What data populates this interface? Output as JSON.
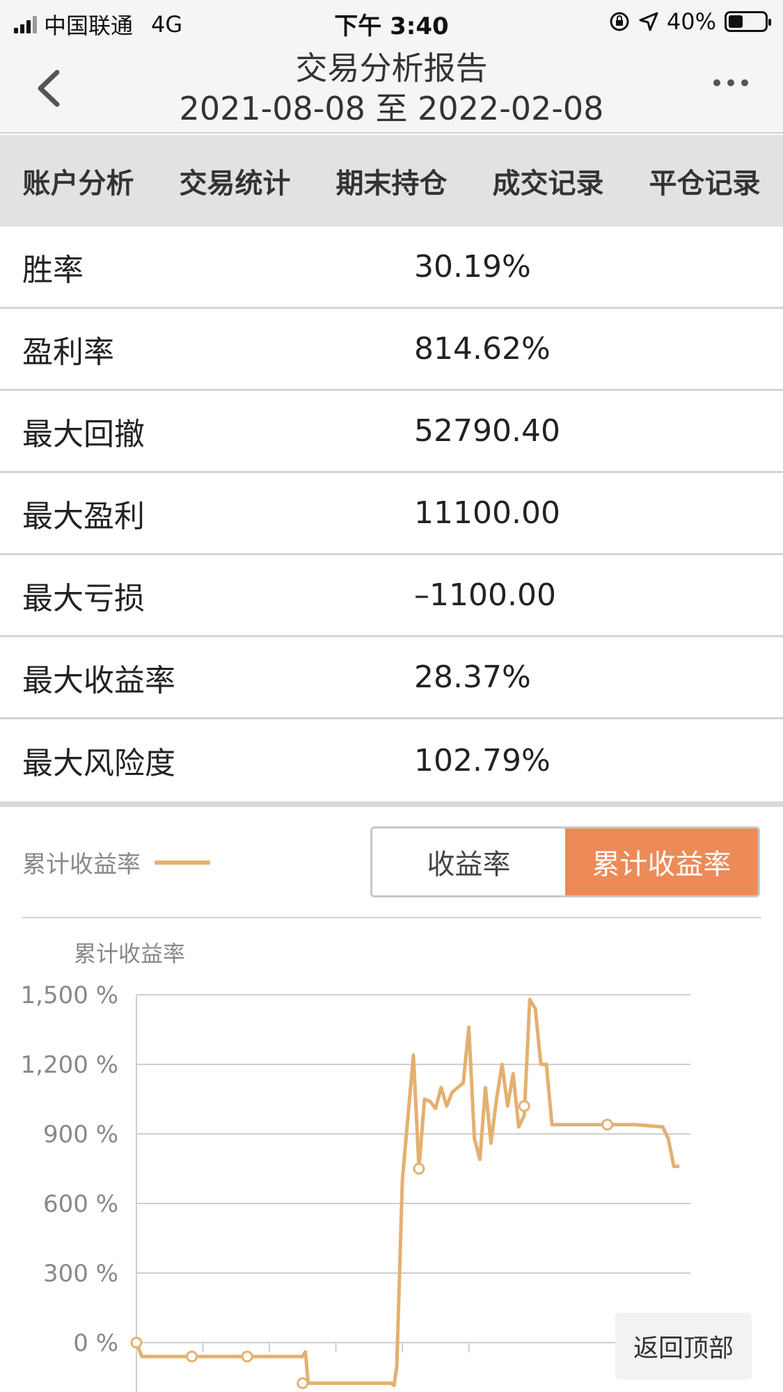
{
  "status_bar": {
    "carrier": "中国联通",
    "network": "4G",
    "time": "下午 3:40",
    "battery": "40%",
    "battery_level": 0.4
  },
  "nav": {
    "title": "交易分析报告",
    "subtitle": "2021-08-08 至 2022-02-08"
  },
  "tabs": [
    {
      "label": "账户分析",
      "active": true
    },
    {
      "label": "交易统计",
      "active": false
    },
    {
      "label": "期末持仓",
      "active": false
    },
    {
      "label": "成交记录",
      "active": false
    },
    {
      "label": "平仓记录",
      "active": false
    }
  ],
  "stats": [
    {
      "label": "胜率",
      "value": "30.19%"
    },
    {
      "label": "盈利率",
      "value": "814.62%"
    },
    {
      "label": "最大回撤",
      "value": "52790.40"
    },
    {
      "label": "最大盈利",
      "value": "11100.00"
    },
    {
      "label": "最大亏损",
      "value": "–1100.00"
    },
    {
      "label": "最大收益率",
      "value": "28.37%"
    },
    {
      "label": "最大风险度",
      "value": "102.79%"
    }
  ],
  "chart_header": {
    "legend_label": "累计收益率",
    "toggle": [
      {
        "label": "收益率",
        "active": false
      },
      {
        "label": "累计收益率",
        "active": true
      }
    ]
  },
  "back_to_top": "返回顶部",
  "colors": {
    "accent": "#ec8a58",
    "line": "#e4b070",
    "active_tab_bg": "#f0c8b8"
  },
  "chart_data": {
    "type": "line",
    "title": "",
    "ylabel": "累计收益率",
    "xlabel": "",
    "ylim": [
      -200,
      1500
    ],
    "yticks": [
      "1,500 %",
      "1,200 %",
      "900 %",
      "600 %",
      "300 %",
      "0 %"
    ],
    "ytick_values": [
      1500,
      1200,
      900,
      600,
      300,
      0
    ],
    "grid": true,
    "legend": "top-left",
    "series": [
      {
        "name": "累计收益率",
        "x": [
          0,
          1,
          10,
          20,
          30,
          30.5,
          31,
          40,
          46,
          46.5,
          47,
          48,
          50,
          51,
          52,
          53,
          54,
          55,
          56,
          57,
          58,
          59,
          60,
          61,
          62,
          63,
          64,
          65,
          66,
          67,
          68,
          69,
          70,
          71,
          72,
          73,
          74,
          75,
          76,
          78,
          80,
          85,
          90,
          95,
          96,
          97,
          98
        ],
        "y": [
          0,
          -60,
          -60,
          -60,
          -60,
          -40,
          -175,
          -175,
          -175,
          -185,
          -100,
          700,
          1240,
          750,
          1050,
          1040,
          1010,
          1100,
          1020,
          1080,
          1100,
          1120,
          1360,
          880,
          790,
          1100,
          860,
          1050,
          1200,
          1020,
          1160,
          930,
          980,
          1480,
          1440,
          1200,
          1200,
          940,
          940,
          940,
          940,
          940,
          940,
          930,
          880,
          760,
          760
        ],
        "markers": [
          [
            0,
            0
          ],
          [
            10,
            -60
          ],
          [
            20,
            -60
          ],
          [
            30,
            -175
          ],
          [
            51,
            750
          ],
          [
            70,
            1020
          ],
          [
            85,
            940
          ]
        ]
      }
    ]
  }
}
